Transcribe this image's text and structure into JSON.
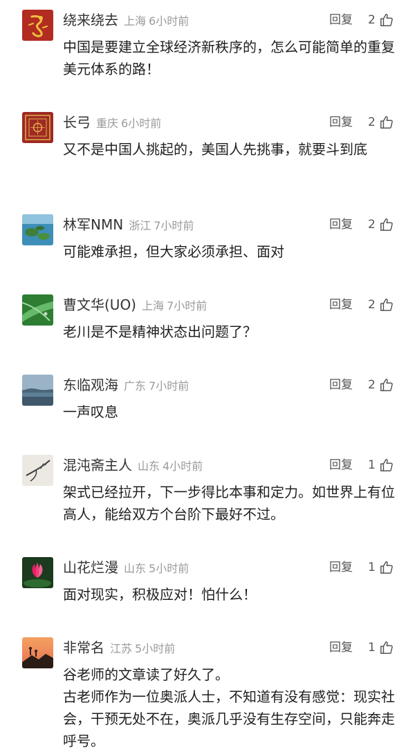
{
  "comments": [
    {
      "username": "绕来绕去",
      "location": "上海",
      "time": "6小时前",
      "reply_label": "回复",
      "likes": "2",
      "avatar": "red-dragon-avatar",
      "text": "中国是要建立全球经济新秩序的，怎么可能简单的重复美元体系的路！"
    },
    {
      "username": "长弓",
      "location": "重庆",
      "time": "6小时前",
      "reply_label": "回复",
      "likes": "2",
      "avatar": "red-pattern-avatar",
      "text": "又不是中国人挑起的，美国人先挑事，就要斗到底"
    },
    {
      "username": "林军NMN",
      "location": "浙江",
      "time": "7小时前",
      "reply_label": "回复",
      "likes": "2",
      "avatar": "lake-islands-avatar",
      "text": "可能难承担，但大家必须承担、面对"
    },
    {
      "username": "曹文华(UO)",
      "location": "上海",
      "time": "7小时前",
      "reply_label": "回复",
      "likes": "2",
      "avatar": "green-leaf-avatar",
      "text": "老川是不是精神状态出问题了？"
    },
    {
      "username": "东临观海",
      "location": "广东",
      "time": "7小时前",
      "reply_label": "回复",
      "likes": "2",
      "avatar": "sea-view-avatar",
      "text": "一声叹息"
    },
    {
      "username": "混沌斋主人",
      "location": "山东",
      "time": "4小时前",
      "reply_label": "回复",
      "likes": "1",
      "avatar": "ink-branch-avatar",
      "text": "架式已经拉开，下一步得比本事和定力。如世界上有位高人，能给双方个台阶下最好不过。"
    },
    {
      "username": "山花烂漫",
      "location": "山东",
      "time": "5小时前",
      "reply_label": "回复",
      "likes": "1",
      "avatar": "lotus-flower-avatar",
      "text": "面对现实，积极应对！怕什么！"
    },
    {
      "username": "非常名",
      "location": "江苏",
      "time": "5小时前",
      "reply_label": "回复",
      "likes": "1",
      "avatar": "sunset-silhouette-avatar",
      "text": "谷老师的文章读了好久了。\n古老师作为一位奥派人士，不知道有没有感觉：现实社会，干预无处不在，奥派几乎没有生存空间，只能奔走呼号。"
    }
  ]
}
